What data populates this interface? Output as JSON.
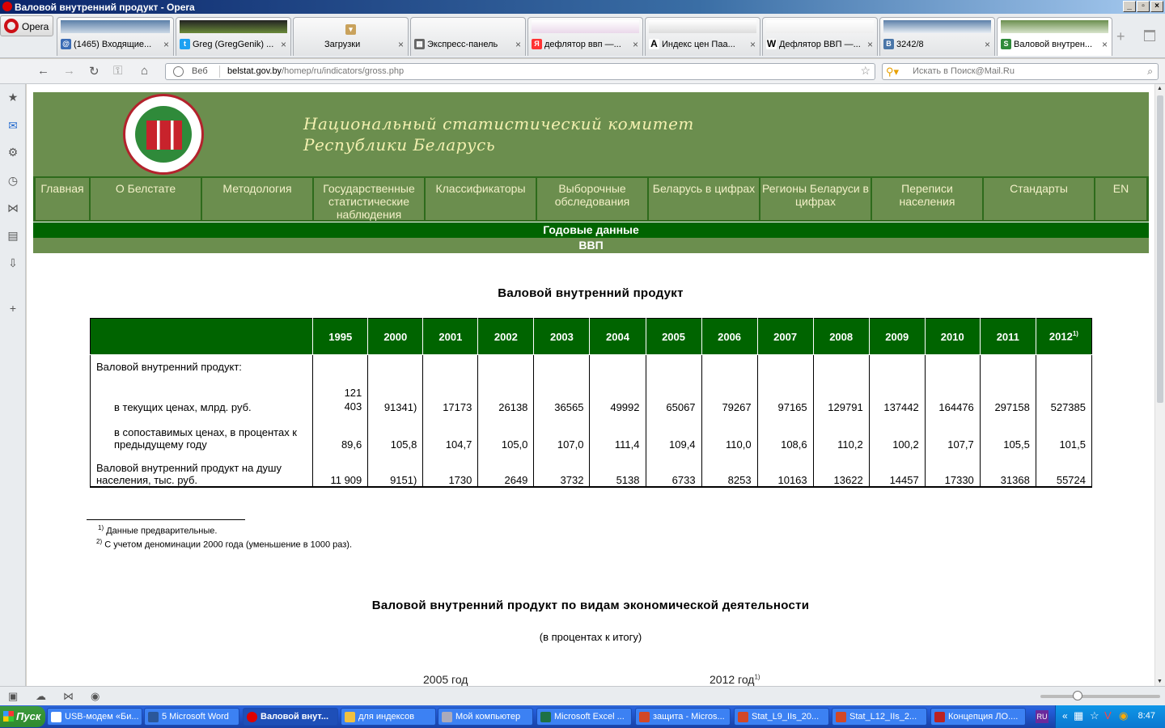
{
  "window": {
    "title": "Валовой внутренний продукт - Opera"
  },
  "browser": {
    "menu_label": "Opera",
    "tabs": [
      {
        "label": "(1465) Входящие..."
      },
      {
        "label": "Greg (GregGenik) ..."
      },
      {
        "label": "Загрузки"
      },
      {
        "label": "Экспресс-панель"
      },
      {
        "label": "дефлятор ввп —..."
      },
      {
        "label": "Индекс цен Паа..."
      },
      {
        "label": "Дефлятор ВВП —..."
      },
      {
        "label": "3242/8"
      },
      {
        "label": "Валовой внутрен..."
      }
    ],
    "address": {
      "prefix": "Веб",
      "host": "belstat.gov.by",
      "path": "/homep/ru/indicators/gross.php"
    },
    "search_placeholder": "Искать в Поиск@Mail.Ru"
  },
  "site": {
    "title_line1": "Национальный статистический комитет",
    "title_line2": "Республики Беларусь",
    "nav": [
      "Главная",
      "О Белстате",
      "Методология",
      "Государственные статистические наблюдения",
      "Классификаторы",
      "Выборочные обследования",
      "Беларусь в цифрах",
      "Регионы Беларуси в цифрах",
      "Переписи населения",
      "Стандарты",
      "EN"
    ],
    "section": "Годовые данные",
    "subsection": "ВВП"
  },
  "main": {
    "heading": "Валовой внутренний продукт",
    "table": {
      "years": [
        "1995",
        "2000",
        "2001",
        "2002",
        "2003",
        "2004",
        "2005",
        "2006",
        "2007",
        "2008",
        "2009",
        "2010",
        "2011",
        "2012"
      ],
      "last_year_note": "1)",
      "rows": [
        {
          "label": "Валовой внутренний продукт:",
          "values": []
        },
        {
          "label": "в текущих ценах, млрд. руб.",
          "values": [
            "121 403",
            "91341)",
            "17173",
            "26138",
            "36565",
            "49992",
            "65067",
            "79267",
            "97165",
            "129791",
            "137442",
            "164476",
            "297158",
            "527385"
          ]
        },
        {
          "label": "в сопоставимых ценах, в процентах к предыдущему году",
          "values": [
            "89,6",
            "105,8",
            "104,7",
            "105,0",
            "107,0",
            "111,4",
            "109,4",
            "110,0",
            "108,6",
            "110,2",
            "100,2",
            "107,7",
            "105,5",
            "101,5"
          ]
        },
        {
          "label": "Валовой внутренний продукт на душу населения, тыс. руб.",
          "values": [
            "11 909",
            "9151)",
            "1730",
            "2649",
            "3732",
            "5138",
            "6733",
            "8253",
            "10163",
            "13622",
            "14457",
            "17330",
            "31368",
            "55724"
          ]
        }
      ]
    },
    "footnotes": [
      {
        "mark": "1)",
        "text": "Данные предварительные."
      },
      {
        "mark": "2)",
        "text": "С учетом деноминации 2000 года (уменьшение в 1000 раз)."
      }
    ],
    "heading2": "Валовой внутренний продукт по видам экономической деятельности",
    "subheading2": "(в процентах к итогу)",
    "col_label_1": "2005 год",
    "col_label_2": "2012 год",
    "col_label_2_note": "1)"
  },
  "taskbar": {
    "start": "Пуск",
    "tasks": [
      "USB-модем «Би...",
      "5 Microsoft Word",
      "Валовой внут...",
      "для индексов",
      "Мой компьютер",
      "Microsoft Excel ...",
      "защита - Micros...",
      "Stat_L9_IIs_20...",
      "Stat_L12_IIs_2...",
      "Концепция ЛО...."
    ],
    "lang": "RU",
    "time": "8:47"
  }
}
